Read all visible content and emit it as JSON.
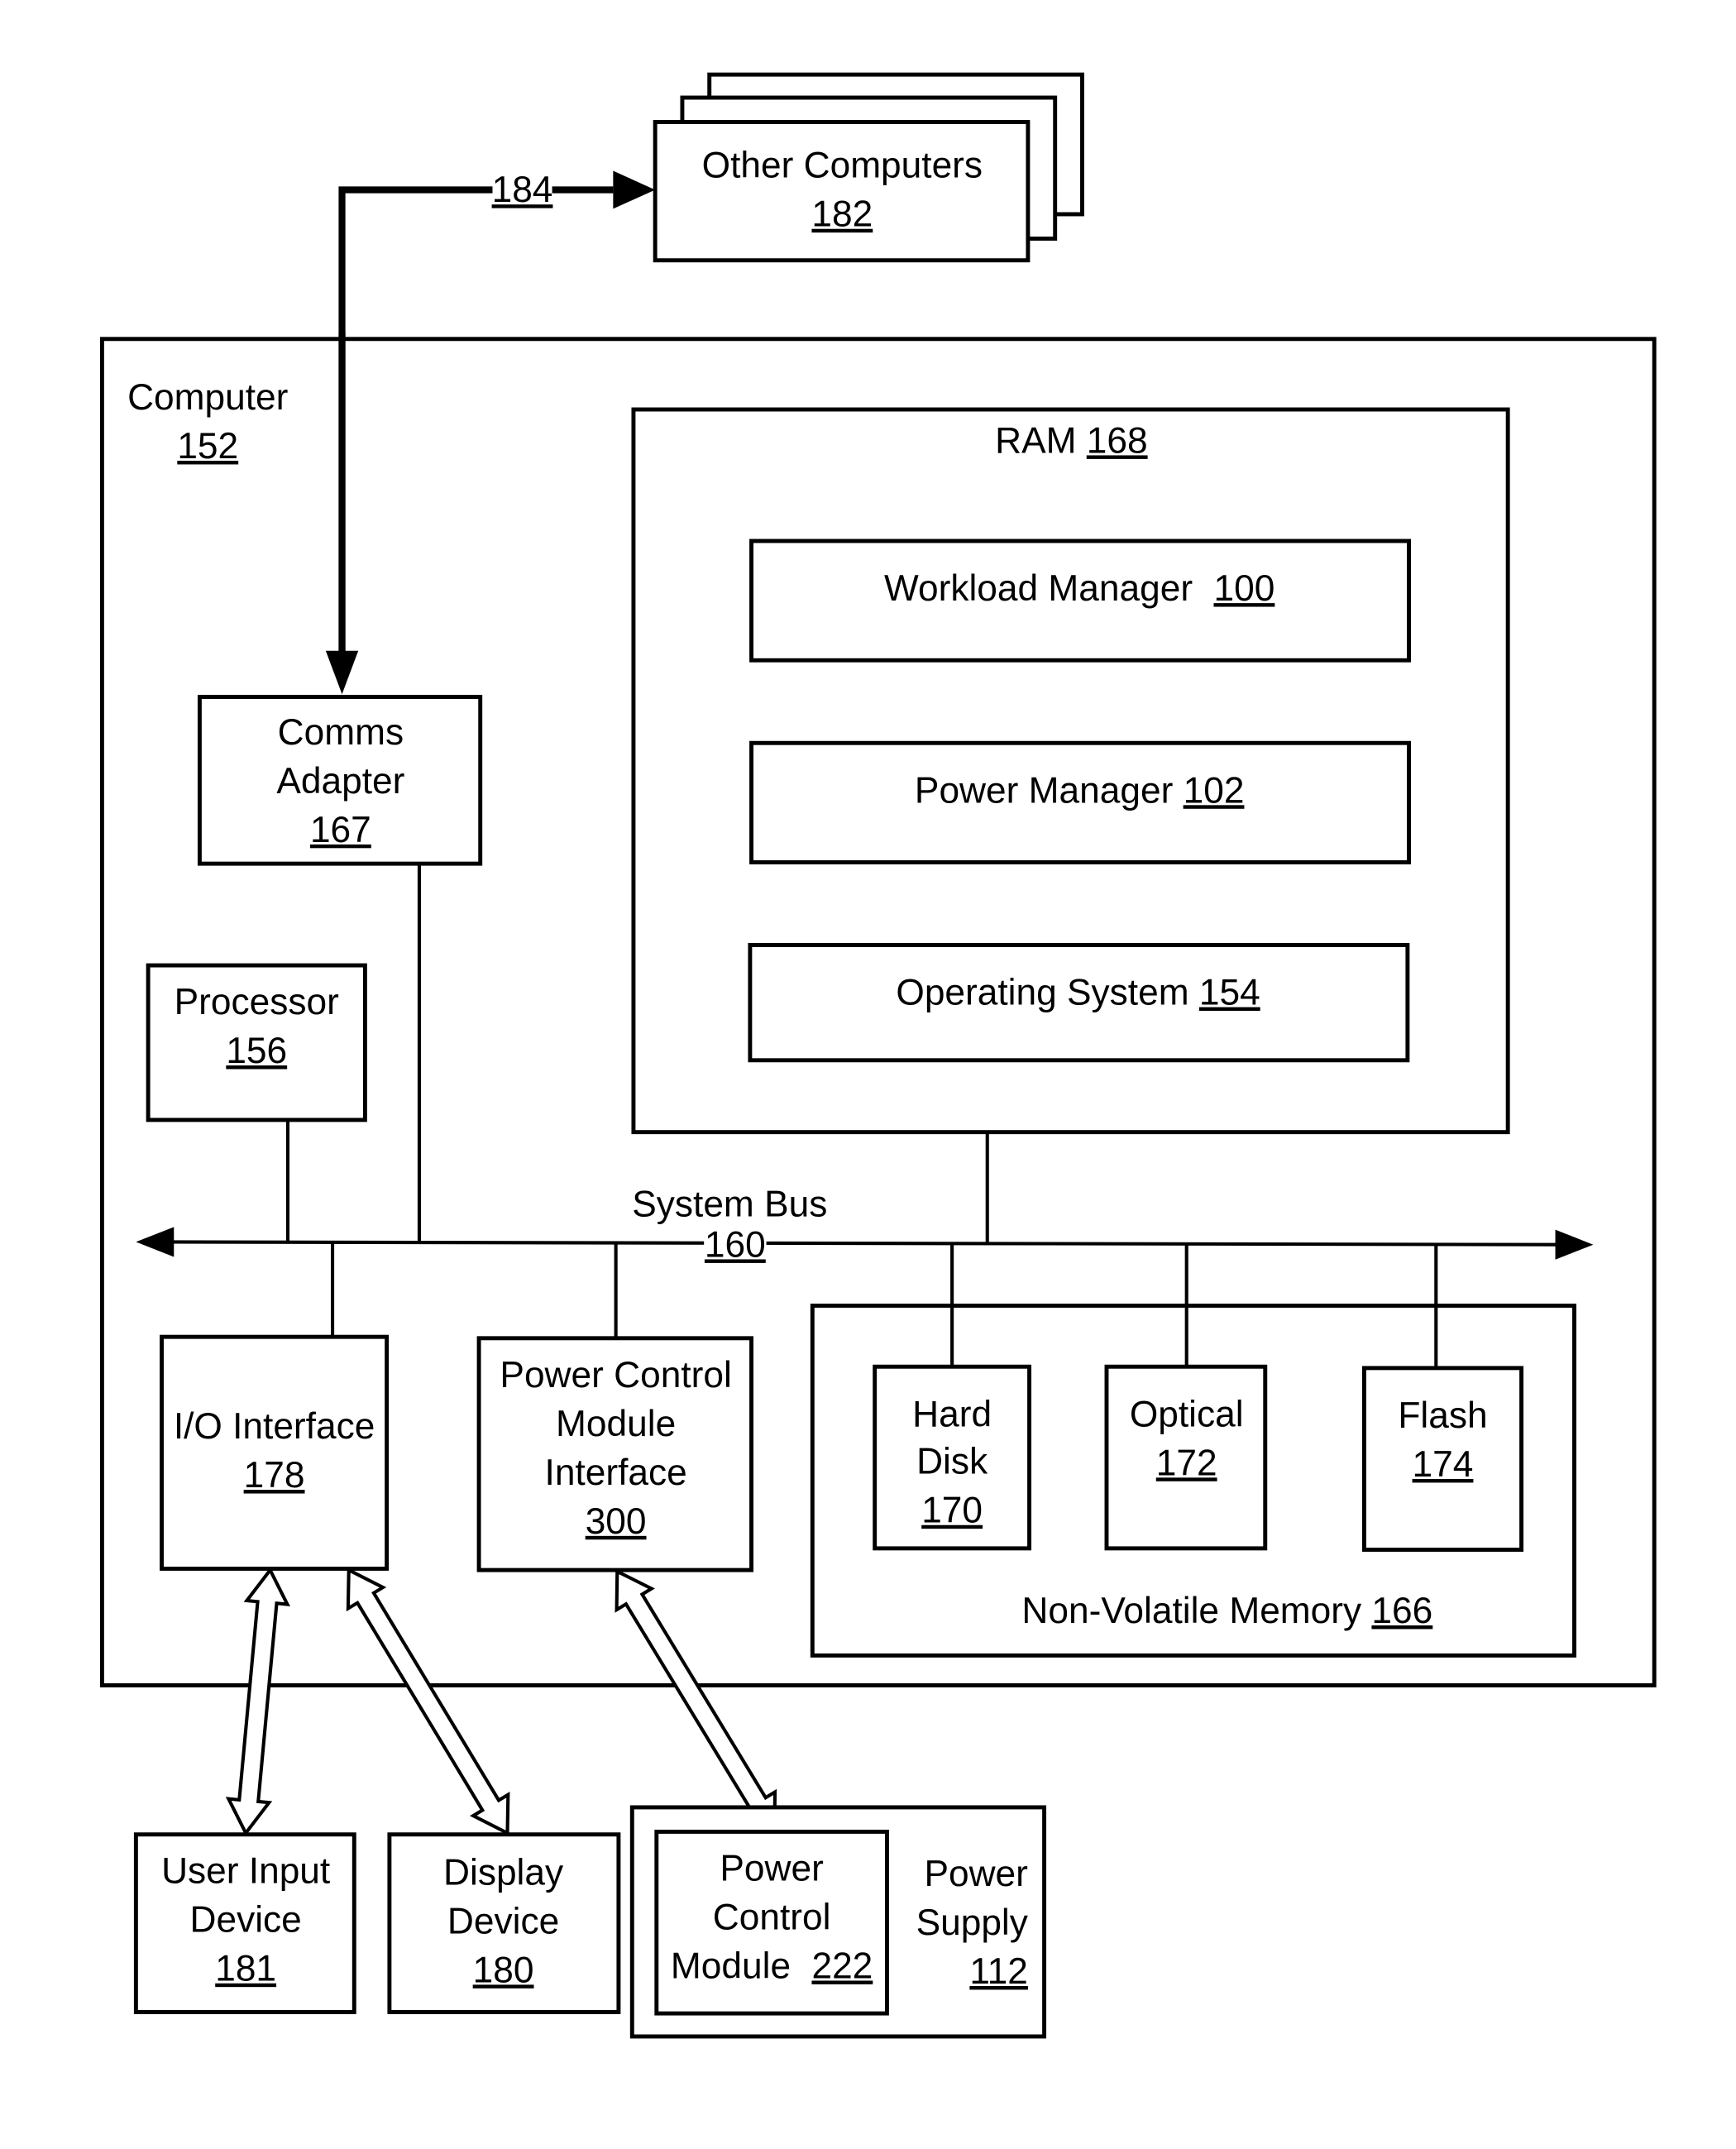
{
  "figure": {
    "other_computers": {
      "label": "Other Computers",
      "ref": "182"
    },
    "network_link": {
      "ref": "184"
    },
    "computer": {
      "label": "Computer",
      "ref": "152"
    },
    "ram": {
      "label": "RAM",
      "ref": "168"
    },
    "workload_manager": {
      "label": "Workload Manager",
      "ref": "100"
    },
    "power_manager": {
      "label": "Power Manager",
      "ref": "102"
    },
    "operating_system": {
      "label": "Operating System",
      "ref": "154"
    },
    "comms_adapter": {
      "label_line1": "Comms",
      "label_line2": "Adapter",
      "ref": "167"
    },
    "processor": {
      "label": "Processor",
      "ref": "156"
    },
    "system_bus": {
      "label": "System Bus",
      "ref": "160"
    },
    "io_interface": {
      "label": "I/O Interface",
      "ref": "178"
    },
    "pcm_interface": {
      "label_line1": "Power Control",
      "label_line2": "Module",
      "label_line3": "Interface",
      "ref": "300"
    },
    "non_volatile_memory": {
      "label": "Non-Volatile Memory",
      "ref": "166"
    },
    "hard_disk": {
      "label_line1": "Hard",
      "label_line2": "Disk",
      "ref": "170"
    },
    "optical": {
      "label": "Optical",
      "ref": "172"
    },
    "flash": {
      "label": "Flash",
      "ref": "174"
    },
    "user_input_device": {
      "label_line1": "User Input",
      "label_line2": "Device",
      "ref": "181"
    },
    "display_device": {
      "label_line1": "Display",
      "label_line2": "Device",
      "ref": "180"
    },
    "power_control_module": {
      "label_line1": "Power",
      "label_line2": "Control",
      "label_line3": "Module",
      "ref": "222"
    },
    "power_supply": {
      "label_line1": "Power",
      "label_line2": "Supply",
      "ref": "112"
    }
  }
}
